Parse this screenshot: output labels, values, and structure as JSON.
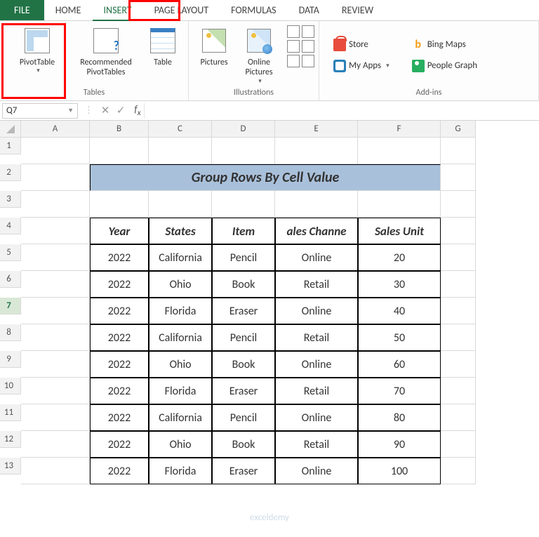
{
  "tabs": {
    "file": "FILE",
    "home": "HOME",
    "insert": "INSERT",
    "pagelayout": "PAGE LAYOUT",
    "formulas": "FORMULAS",
    "data": "DATA",
    "review": "REVIEW"
  },
  "ribbon": {
    "tables": {
      "label": "Tables",
      "pivot": "PivotTable",
      "recommended": "Recommended\nPivotTables",
      "table": "Table"
    },
    "illustrations": {
      "label": "Illustrations",
      "pictures": "Pictures",
      "online": "Online\nPictures"
    },
    "addins": {
      "label": "Add-ins",
      "store": "Store",
      "myapps": "My Apps",
      "bing": "Bing Maps",
      "people": "People Graph"
    }
  },
  "namebox": "Q7",
  "columns": [
    "A",
    "B",
    "C",
    "D",
    "E",
    "F",
    "G"
  ],
  "title": "Group Rows By Cell Value",
  "headers": {
    "b": "Year",
    "c": "States",
    "d": "Item",
    "e": "ales Channe",
    "f": "Sales Unit"
  },
  "rows": [
    {
      "n": "5",
      "b": "2022",
      "c": "California",
      "d": "Pencil",
      "e": "Online",
      "f": "20"
    },
    {
      "n": "6",
      "b": "2022",
      "c": "Ohio",
      "d": "Book",
      "e": "Retail",
      "f": "30"
    },
    {
      "n": "7",
      "b": "2022",
      "c": "Florida",
      "d": "Eraser",
      "e": "Online",
      "f": "40"
    },
    {
      "n": "8",
      "b": "2022",
      "c": "California",
      "d": "Pencil",
      "e": "Retail",
      "f": "50"
    },
    {
      "n": "9",
      "b": "2022",
      "c": "Ohio",
      "d": "Book",
      "e": "Online",
      "f": "60"
    },
    {
      "n": "10",
      "b": "2022",
      "c": "Florida",
      "d": "Eraser",
      "e": "Retail",
      "f": "70"
    },
    {
      "n": "11",
      "b": "2022",
      "c": "California",
      "d": "Pencil",
      "e": "Online",
      "f": "80"
    },
    {
      "n": "12",
      "b": "2022",
      "c": "Ohio",
      "d": "Book",
      "e": "Retail",
      "f": "90"
    },
    {
      "n": "13",
      "b": "2022",
      "c": "Florida",
      "d": "Eraser",
      "e": "Online",
      "f": "100"
    }
  ],
  "watermark": "exceldemy"
}
